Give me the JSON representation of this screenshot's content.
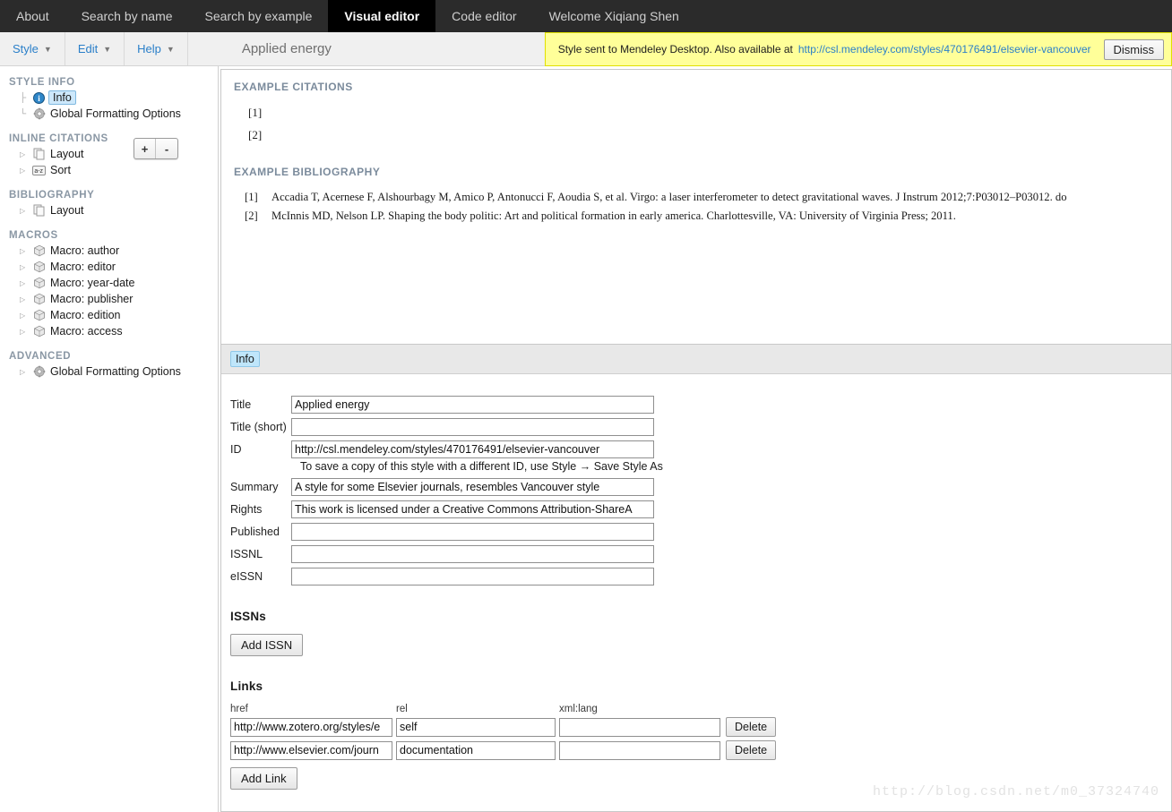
{
  "topnav": {
    "items": [
      {
        "label": "About",
        "active": false
      },
      {
        "label": "Search by name",
        "active": false
      },
      {
        "label": "Search by example",
        "active": false
      },
      {
        "label": "Visual editor",
        "active": true
      },
      {
        "label": "Code editor",
        "active": false
      },
      {
        "label": "Welcome Xiqiang Shen",
        "active": false
      }
    ]
  },
  "toolbar": {
    "menus": [
      {
        "label": "Style"
      },
      {
        "label": "Edit"
      },
      {
        "label": "Help"
      }
    ],
    "doc_title": "Applied energy",
    "notification": {
      "text": "Style sent to Mendeley Desktop. Also available at",
      "link": "http://csl.mendeley.com/styles/470176491/elsevier-vancouver",
      "dismiss_label": "Dismiss",
      "bg_color": "#ffff99"
    }
  },
  "sidebar": {
    "zoom_in_label": "+",
    "zoom_out_label": "-",
    "groups": [
      {
        "title": "STYLE INFO",
        "nodes": [
          {
            "label": "Info",
            "icon": "info-icon",
            "selected": true,
            "twisty": "mid"
          },
          {
            "label": "Global Formatting Options",
            "icon": "gear-icon",
            "selected": false,
            "twisty": "leaf"
          }
        ]
      },
      {
        "title": "INLINE CITATIONS",
        "nodes": [
          {
            "label": "Layout",
            "icon": "pages-icon",
            "selected": false,
            "twisty": "exp"
          },
          {
            "label": "Sort",
            "icon": "az-sort-icon",
            "selected": false,
            "twisty": "exp"
          }
        ]
      },
      {
        "title": "BIBLIOGRAPHY",
        "nodes": [
          {
            "label": "Layout",
            "icon": "pages-icon",
            "selected": false,
            "twisty": "exp"
          }
        ]
      },
      {
        "title": "MACROS",
        "nodes": [
          {
            "label": "Macro: author",
            "icon": "box-icon",
            "selected": false,
            "twisty": "exp"
          },
          {
            "label": "Macro: editor",
            "icon": "box-icon",
            "selected": false,
            "twisty": "exp"
          },
          {
            "label": "Macro: year-date",
            "icon": "box-icon",
            "selected": false,
            "twisty": "exp"
          },
          {
            "label": "Macro: publisher",
            "icon": "box-icon",
            "selected": false,
            "twisty": "exp"
          },
          {
            "label": "Macro: edition",
            "icon": "box-icon",
            "selected": false,
            "twisty": "exp"
          },
          {
            "label": "Macro: access",
            "icon": "box-icon",
            "selected": false,
            "twisty": "exp"
          }
        ]
      },
      {
        "title": "ADVANCED",
        "nodes": [
          {
            "label": "Global Formatting Options",
            "icon": "gear-icon",
            "selected": false,
            "twisty": "exp"
          }
        ]
      }
    ]
  },
  "preview": {
    "citations_heading": "EXAMPLE CITATIONS",
    "citations": [
      "[1]",
      "[2]"
    ],
    "bibliography_heading": "EXAMPLE BIBLIOGRAPHY",
    "bibliography": [
      {
        "num": "[1]",
        "text": "Accadia T, Acernese F, Alshourbagy M, Amico P, Antonucci F, Aoudia S, et al. Virgo: a laser interferometer to detect gravitational waves. J Instrum 2012;7:P03012–P03012. do"
      },
      {
        "num": "[2]",
        "text": "McInnis MD, Nelson LP. Shaping the body politic: Art and political formation in early america. Charlottesville, VA: University of Virginia Press; 2011."
      }
    ]
  },
  "info_panel": {
    "tabs": [
      {
        "label": "Info",
        "active": true
      }
    ],
    "fields": [
      {
        "label": "Title",
        "value": "Applied energy"
      },
      {
        "label": "Title (short)",
        "value": ""
      },
      {
        "label": "ID",
        "value": "http://csl.mendeley.com/styles/470176491/elsevier-vancouver"
      },
      {
        "label": "Summary",
        "value": "A style for some Elsevier journals, resembles Vancouver style"
      },
      {
        "label": "Rights",
        "value": "This work is licensed under a Creative Commons Attribution-ShareA"
      },
      {
        "label": "Published",
        "value": ""
      },
      {
        "label": "ISSNL",
        "value": ""
      },
      {
        "label": "eISSN",
        "value": ""
      }
    ],
    "id_helper": "To save a copy of this style with a different ID, use Style → Save Style As",
    "issns": {
      "heading": "ISSNs",
      "add_label": "Add ISSN"
    },
    "links": {
      "heading": "Links",
      "columns": [
        "href",
        "rel",
        "xml:lang"
      ],
      "rows": [
        {
          "href": "http://www.zotero.org/styles/e",
          "rel": "self",
          "lang": "",
          "delete_label": "Delete"
        },
        {
          "href": "http://www.elsevier.com/journ",
          "rel": "documentation",
          "lang": "",
          "delete_label": "Delete"
        }
      ],
      "add_label": "Add Link"
    }
  },
  "watermark": "http://blog.csdn.net/m0_37324740"
}
